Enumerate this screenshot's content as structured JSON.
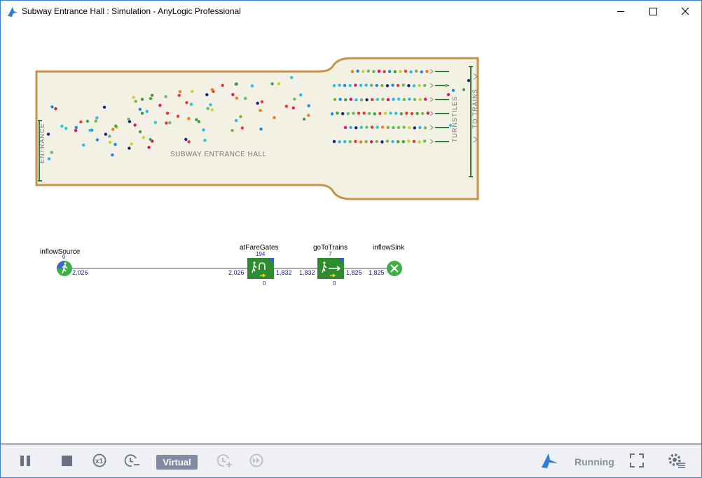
{
  "window": {
    "title": "Subway Entrance Hall : Simulation - AnyLogic Professional",
    "accent": "#3a7bd5"
  },
  "hall": {
    "title": "SUBWAY ENTRANCE HALL",
    "entrance_label": "ENTRANCE",
    "turnstiles_label": "TURNSTILES",
    "trains_label": "TO TRAINS",
    "floor_color": "#f3f1e3",
    "wall_color": "#c8924a"
  },
  "flowchart": {
    "source": {
      "name": "inflowSource",
      "top_count": "0",
      "out_count": "2,026"
    },
    "fare_gates": {
      "name": "atFareGates",
      "top_count": "194",
      "in_count": "2,026",
      "out_count": "1,832",
      "bottom_count": "0"
    },
    "go_to_trains": {
      "name": "goToTrains",
      "top_count": "7",
      "in_count": "1,832",
      "out_count": "1,825",
      "bottom_count": "0"
    },
    "sink": {
      "name": "inflowSink",
      "in_count": "1,825"
    },
    "block_color": "#2e8b2e",
    "count_color": "#1a1aa0"
  },
  "toolbar": {
    "pause_icon": "pause-icon",
    "stop_icon": "stop-icon",
    "speed_label": "x1",
    "mode": "Virtual",
    "status": "Running",
    "buttons": [
      "pause",
      "stop",
      "speed-x1",
      "slow-down",
      "virtual-mode",
      "speed-up",
      "run-to-end",
      "anylogic-logo",
      "fullscreen",
      "settings"
    ]
  }
}
